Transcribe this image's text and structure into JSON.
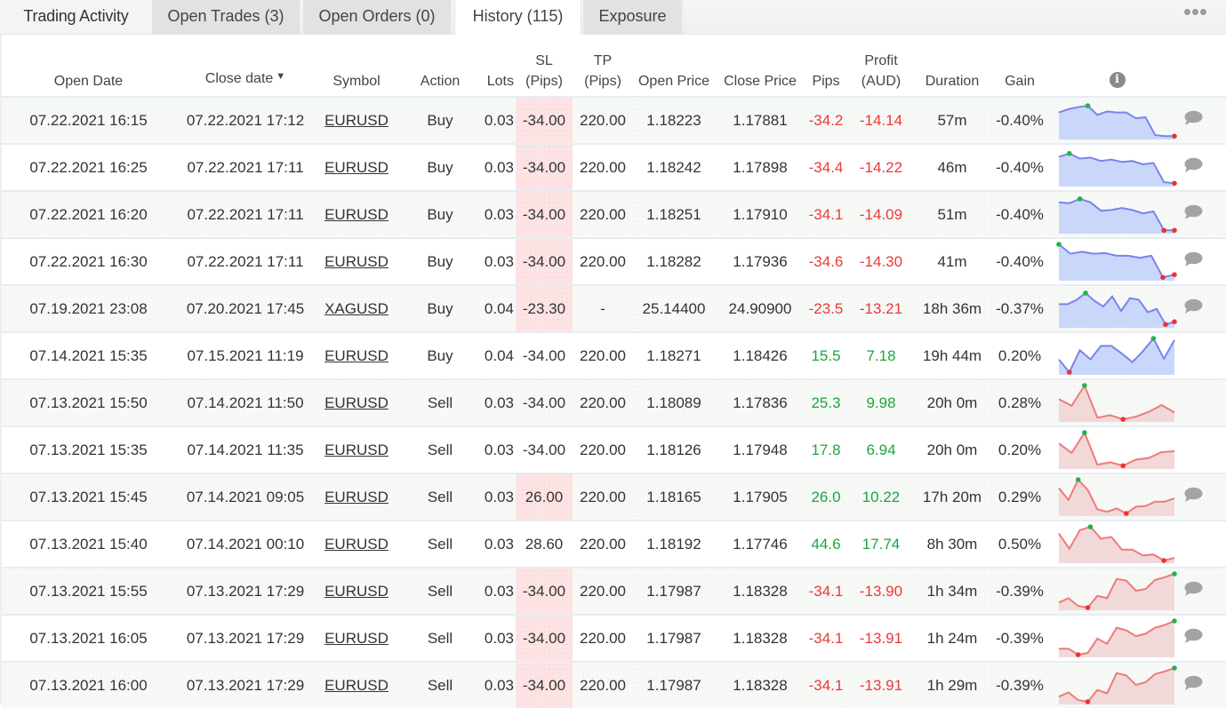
{
  "tabs": {
    "title": "Trading Activity",
    "items": [
      {
        "label": "Open Trades (3)",
        "active": false
      },
      {
        "label": "Open Orders (0)",
        "active": false
      },
      {
        "label": "History (115)",
        "active": true
      },
      {
        "label": "Exposure",
        "active": false
      }
    ],
    "more_icon": "more-horizontal-icon"
  },
  "columns": {
    "open_date": "Open Date",
    "close_date": "Close date",
    "close_date_sort": "▼",
    "symbol": "Symbol",
    "action": "Action",
    "lots": "Lots",
    "sl_1": "SL",
    "sl_2": "(Pips)",
    "tp_1": "TP",
    "tp_2": "(Pips)",
    "open_price": "Open Price",
    "close_price": "Close Price",
    "pips": "Pips",
    "profit_1": "Profit",
    "profit_2": "(AUD)",
    "duration": "Duration",
    "gain": "Gain",
    "info_icon_glyph": "i"
  },
  "colors": {
    "positive": "#1ea53a",
    "negative": "#e83a3a",
    "sl_highlight": "#fde4e4",
    "spark_buy_line": "#7b83ee",
    "spark_buy_fill": "#c9d7fb",
    "spark_sell_line": "#f07a7a",
    "spark_sell_fill": "#f1d9d9",
    "marker_high": "#22b24c",
    "marker_low": "#f03030"
  },
  "rows": [
    {
      "open_date": "07.22.2021 16:15",
      "close_date": "07.22.2021 17:12",
      "symbol": "EURUSD",
      "action": "Buy",
      "lots": "0.03",
      "sl": "-34.00",
      "sl_hit": true,
      "tp": "220.00",
      "open_price": "1.18223",
      "close_price": "1.17881",
      "pips": "-34.2",
      "profit": "-14.14",
      "duration": "57m",
      "gain": "-0.40%",
      "positive": false,
      "comment": true,
      "spark": {
        "type": "buy",
        "values": [
          0.72,
          0.82,
          0.88,
          0.92,
          0.65,
          0.75,
          0.72,
          0.72,
          0.55,
          0.58,
          0.05,
          0.02,
          0.02
        ],
        "high": 3,
        "low": [
          12
        ]
      }
    },
    {
      "open_date": "07.22.2021 16:25",
      "close_date": "07.22.2021 17:11",
      "symbol": "EURUSD",
      "action": "Buy",
      "lots": "0.03",
      "sl": "-34.00",
      "sl_hit": true,
      "tp": "220.00",
      "open_price": "1.18242",
      "close_price": "1.17898",
      "pips": "-34.4",
      "profit": "-14.22",
      "duration": "46m",
      "gain": "-0.40%",
      "positive": false,
      "comment": true,
      "spark": {
        "type": "buy",
        "values": [
          0.8,
          0.9,
          0.75,
          0.78,
          0.68,
          0.72,
          0.65,
          0.68,
          0.58,
          0.62,
          0.05,
          0.02
        ],
        "high": 1,
        "low": [
          11
        ]
      }
    },
    {
      "open_date": "07.22.2021 16:20",
      "close_date": "07.22.2021 17:11",
      "symbol": "EURUSD",
      "action": "Buy",
      "lots": "0.03",
      "sl": "-34.00",
      "sl_hit": true,
      "tp": "220.00",
      "open_price": "1.18251",
      "close_price": "1.17910",
      "pips": "-34.1",
      "profit": "-14.09",
      "duration": "51m",
      "gain": "-0.40%",
      "positive": false,
      "comment": true,
      "spark": {
        "type": "buy",
        "values": [
          0.85,
          0.82,
          0.95,
          0.85,
          0.6,
          0.62,
          0.68,
          0.62,
          0.52,
          0.58,
          0.02,
          0.02
        ],
        "high": 2,
        "low": [
          10,
          11
        ]
      }
    },
    {
      "open_date": "07.22.2021 16:30",
      "close_date": "07.22.2021 17:11",
      "symbol": "EURUSD",
      "action": "Buy",
      "lots": "0.03",
      "sl": "-34.00",
      "sl_hit": true,
      "tp": "220.00",
      "open_price": "1.18282",
      "close_price": "1.17936",
      "pips": "-34.6",
      "profit": "-14.30",
      "duration": "41m",
      "gain": "-0.40%",
      "positive": false,
      "comment": true,
      "spark": {
        "type": "buy",
        "values": [
          1.0,
          0.72,
          0.78,
          0.72,
          0.74,
          0.66,
          0.66,
          0.6,
          0.66,
          0.02,
          0.1
        ],
        "high": 0,
        "low": [
          9,
          10
        ]
      }
    },
    {
      "open_date": "07.19.2021 23:08",
      "close_date": "07.20.2021 17:45",
      "symbol": "XAGUSD",
      "action": "Buy",
      "lots": "0.04",
      "sl": "-23.30",
      "sl_hit": true,
      "tp": "-",
      "open_price": "25.14400",
      "close_price": "24.90900",
      "pips": "-23.5",
      "profit": "-13.21",
      "duration": "18h 36m",
      "gain": "-0.37%",
      "positive": false,
      "comment": true,
      "spark": {
        "type": "buy",
        "values": [
          0.62,
          0.62,
          0.75,
          0.95,
          0.72,
          0.55,
          0.85,
          0.42,
          0.8,
          0.75,
          0.38,
          0.48,
          0.02,
          0.1
        ],
        "high": 3,
        "low": [
          12,
          13
        ]
      }
    },
    {
      "open_date": "07.14.2021 15:35",
      "close_date": "07.15.2021 11:19",
      "symbol": "EURUSD",
      "action": "Buy",
      "lots": "0.04",
      "sl": "-34.00",
      "sl_hit": false,
      "tp": "220.00",
      "open_price": "1.18271",
      "close_price": "1.18426",
      "pips": "15.5",
      "profit": "7.18",
      "duration": "19h 44m",
      "gain": "0.20%",
      "positive": true,
      "comment": false,
      "spark": {
        "type": "buy",
        "values": [
          0.38,
          0.0,
          0.65,
          0.38,
          0.78,
          0.78,
          0.55,
          0.3,
          0.62,
          1.0,
          0.4,
          0.95
        ],
        "high": 9,
        "low": [
          1
        ]
      }
    },
    {
      "open_date": "07.13.2021 15:50",
      "close_date": "07.14.2021 11:50",
      "symbol": "EURUSD",
      "action": "Sell",
      "lots": "0.03",
      "sl": "-34.00",
      "sl_hit": false,
      "tp": "220.00",
      "open_price": "1.18089",
      "close_price": "1.17836",
      "pips": "25.3",
      "profit": "9.98",
      "duration": "20h 0m",
      "gain": "0.28%",
      "positive": true,
      "comment": false,
      "spark": {
        "type": "sell",
        "values": [
          0.6,
          0.4,
          1.0,
          0.05,
          0.12,
          0.0,
          0.08,
          0.22,
          0.42,
          0.2
        ],
        "high": 2,
        "low": [
          5
        ]
      }
    },
    {
      "open_date": "07.13.2021 15:35",
      "close_date": "07.14.2021 11:35",
      "symbol": "EURUSD",
      "action": "Sell",
      "lots": "0.03",
      "sl": "-34.00",
      "sl_hit": false,
      "tp": "220.00",
      "open_price": "1.18126",
      "close_price": "1.17948",
      "pips": "17.8",
      "profit": "6.94",
      "duration": "20h 0m",
      "gain": "0.20%",
      "positive": true,
      "comment": false,
      "spark": {
        "type": "sell",
        "values": [
          0.68,
          0.4,
          1.0,
          0.05,
          0.12,
          0.02,
          0.2,
          0.25,
          0.42,
          0.45
        ],
        "high": 2,
        "low": [
          5
        ]
      }
    },
    {
      "open_date": "07.13.2021 15:45",
      "close_date": "07.14.2021 09:05",
      "symbol": "EURUSD",
      "action": "Sell",
      "lots": "0.03",
      "sl": "26.00",
      "sl_hit": true,
      "tp": "220.00",
      "open_price": "1.18165",
      "close_price": "1.17905",
      "pips": "26.0",
      "profit": "10.22",
      "duration": "17h 20m",
      "gain": "0.29%",
      "positive": true,
      "comment": true,
      "spark": {
        "type": "sell",
        "values": [
          0.75,
          0.4,
          1.0,
          0.7,
          0.12,
          0.05,
          0.15,
          0.0,
          0.2,
          0.22,
          0.35,
          0.35,
          0.45
        ],
        "high": 2,
        "low": [
          7
        ]
      }
    },
    {
      "open_date": "07.13.2021 15:40",
      "close_date": "07.14.2021 00:10",
      "symbol": "EURUSD",
      "action": "Sell",
      "lots": "0.03",
      "sl": "28.60",
      "sl_hit": false,
      "tp": "220.00",
      "open_price": "1.18192",
      "close_price": "1.17746",
      "pips": "44.6",
      "profit": "17.74",
      "duration": "8h 30m",
      "gain": "0.50%",
      "positive": true,
      "comment": false,
      "spark": {
        "type": "sell",
        "values": [
          0.8,
          0.35,
          0.9,
          1.0,
          0.65,
          0.7,
          0.32,
          0.32,
          0.15,
          0.18,
          0.0,
          0.08
        ],
        "high": 3,
        "low": [
          10
        ]
      }
    },
    {
      "open_date": "07.13.2021 15:55",
      "close_date": "07.13.2021 17:29",
      "symbol": "EURUSD",
      "action": "Sell",
      "lots": "0.03",
      "sl": "-34.00",
      "sl_hit": true,
      "tp": "220.00",
      "open_price": "1.17987",
      "close_price": "1.18328",
      "pips": "-34.1",
      "profit": "-13.90",
      "duration": "1h 34m",
      "gain": "-0.39%",
      "positive": false,
      "comment": true,
      "spark": {
        "type": "sell",
        "values": [
          0.15,
          0.28,
          0.05,
          0.0,
          0.35,
          0.28,
          0.85,
          0.8,
          0.5,
          0.55,
          0.82,
          0.9,
          1.0
        ],
        "high": 12,
        "low": [
          3
        ]
      }
    },
    {
      "open_date": "07.13.2021 16:05",
      "close_date": "07.13.2021 17:29",
      "symbol": "EURUSD",
      "action": "Sell",
      "lots": "0.03",
      "sl": "-34.00",
      "sl_hit": true,
      "tp": "220.00",
      "open_price": "1.17987",
      "close_price": "1.18328",
      "pips": "-34.1",
      "profit": "-13.91",
      "duration": "1h 24m",
      "gain": "-0.39%",
      "positive": false,
      "comment": true,
      "spark": {
        "type": "sell",
        "values": [
          0.18,
          0.18,
          0.0,
          0.05,
          0.48,
          0.32,
          0.8,
          0.72,
          0.55,
          0.62,
          0.8,
          0.88,
          1.0
        ],
        "high": 12,
        "low": [
          2
        ]
      }
    },
    {
      "open_date": "07.13.2021 16:00",
      "close_date": "07.13.2021 17:29",
      "symbol": "EURUSD",
      "action": "Sell",
      "lots": "0.03",
      "sl": "-34.00",
      "sl_hit": true,
      "tp": "220.00",
      "open_price": "1.17987",
      "close_price": "1.18328",
      "pips": "-34.1",
      "profit": "-13.91",
      "duration": "1h 29m",
      "gain": "-0.39%",
      "positive": false,
      "comment": true,
      "spark": {
        "type": "sell",
        "values": [
          0.15,
          0.28,
          0.05,
          0.0,
          0.35,
          0.25,
          0.85,
          0.78,
          0.5,
          0.58,
          0.82,
          0.9,
          1.0
        ],
        "high": 12,
        "low": [
          3
        ]
      }
    }
  ]
}
